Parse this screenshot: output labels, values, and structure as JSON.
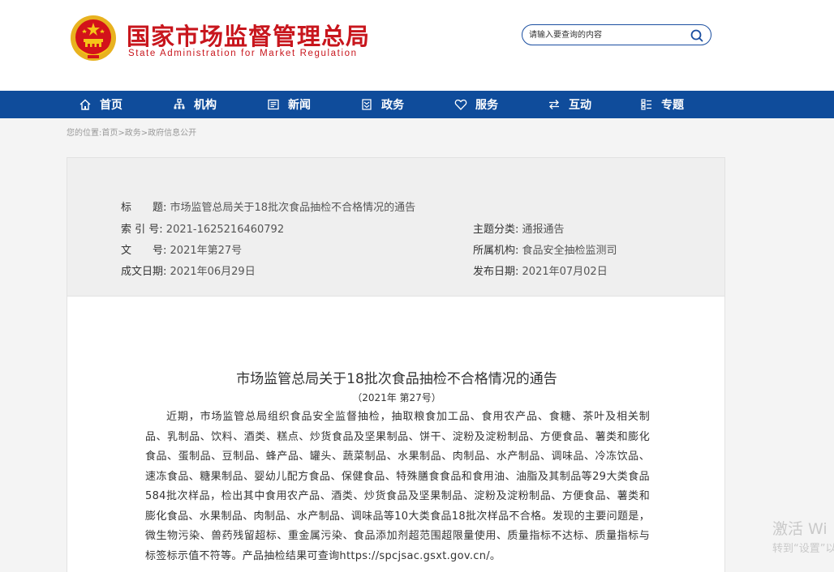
{
  "header": {
    "title_cn": "国家市场监督管理总局",
    "title_en": "State Administration for Market Regulation",
    "search_placeholder": "请输入要查询的内容"
  },
  "nav": {
    "items": [
      {
        "label": "首页",
        "icon": "home-icon"
      },
      {
        "label": "机构",
        "icon": "org-chart-icon"
      },
      {
        "label": "新闻",
        "icon": "news-icon"
      },
      {
        "label": "政务",
        "icon": "government-affairs-icon"
      },
      {
        "label": "服务",
        "icon": "heart-icon"
      },
      {
        "label": "互动",
        "icon": "exchange-arrows-icon"
      },
      {
        "label": "专题",
        "icon": "topics-icon"
      }
    ]
  },
  "breadcrumb": {
    "prefix": "您的位置:",
    "items": [
      "首页",
      "政务",
      "政府信息公开"
    ],
    "separator": ">"
  },
  "meta": {
    "title_label": "标　　题:",
    "title_value": "市场监管总局关于18批次食品抽检不合格情况的通告",
    "index_label": "索 引 号:",
    "index_value": "2021-1625216460792",
    "topic_label": "主题分类:",
    "topic_value": "通报通告",
    "doc_label": "文　　号:",
    "doc_value": "2021年第27号",
    "agency_label": "所属机构:",
    "agency_value": "食品安全抽检监测司",
    "created_label": "成文日期:",
    "created_value": "2021年06月29日",
    "published_label": "发布日期:",
    "published_value": "2021年07月02日"
  },
  "document": {
    "title": "市场监管总局关于18批次食品抽检不合格情况的通告",
    "number": "（2021年 第27号）",
    "body": "近期，市场监管总局组织食品安全监督抽检，抽取粮食加工品、食用农产品、食糖、茶叶及相关制品、乳制品、饮料、酒类、糕点、炒货食品及坚果制品、饼干、淀粉及淀粉制品、方便食品、薯类和膨化食品、蛋制品、豆制品、蜂产品、罐头、蔬菜制品、水果制品、肉制品、水产制品、调味品、冷冻饮品、速冻食品、糖果制品、婴幼儿配方食品、保健食品、特殊膳食食品和食用油、油脂及其制品等29大类食品584批次样品，检出其中食用农产品、酒类、炒货食品及坚果制品、淀粉及淀粉制品、方便食品、薯类和膨化食品、水果制品、肉制品、水产制品、调味品等10大类食品18批次样品不合格。发现的主要问题是，微生物污染、兽药残留超标、重金属污染、食品添加剂超范围超限量使用、质量指标不达标、质量指标与标签标示值不符等。产品抽检结果可查询https://spcjsac.gsxt.gov.cn/。"
  },
  "watermark": {
    "line1": "激活 Wi",
    "line2": "转到“设置”以"
  },
  "colors": {
    "brand_red": "#c8161d",
    "nav_blue": "#0f4c9b"
  }
}
